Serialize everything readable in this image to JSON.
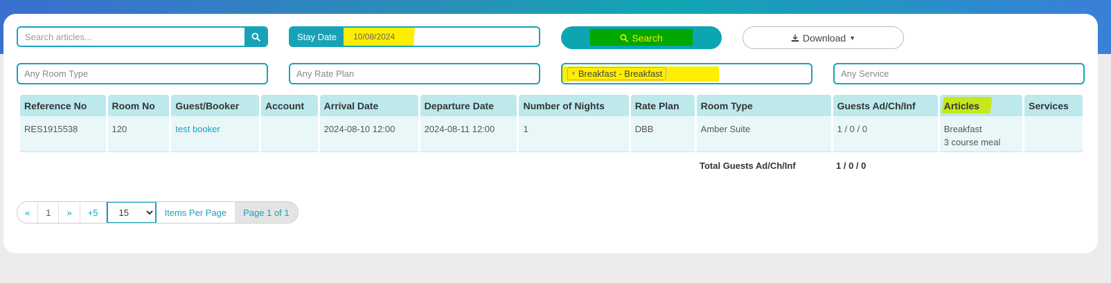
{
  "filters": {
    "search_placeholder": "Search articles...",
    "stay_date_label": "Stay Date",
    "stay_date_value": "10/08/2024",
    "search_button": "Search",
    "download_button": "Download",
    "room_type_placeholder": "Any Room Type",
    "rate_plan_placeholder": "Any Rate Plan",
    "article_tag": "Breakfast - Breakfast",
    "service_placeholder": "Any Service"
  },
  "table": {
    "headers": [
      "Reference No",
      "Room No",
      "Guest/Booker",
      "Account",
      "Arrival Date",
      "Departure Date",
      "Number of Nights",
      "Rate Plan",
      "Room Type",
      "Guests Ad/Ch/Inf",
      "Articles",
      "Services"
    ],
    "rows": [
      {
        "reference": "RES1915538",
        "room": "120",
        "guest": "test booker",
        "account": "",
        "arrival": "2024-08-10 12:00",
        "departure": "2024-08-11 12:00",
        "nights": "1",
        "rate_plan": "DBB",
        "room_type": "Amber Suite",
        "guests": "1 / 0 / 0",
        "articles_line1": "Breakfast",
        "articles_line2": "3 course meal",
        "services": ""
      }
    ],
    "totals_label": "Total Guests Ad/Ch/Inf",
    "totals_value": "1 / 0 / 0"
  },
  "pagination": {
    "first": "«",
    "page": "1",
    "next": "»",
    "plus": "+5",
    "per_page": "15",
    "items_per_page_label": "Items Per Page",
    "page_info": "Page 1 of 1"
  },
  "colors": {
    "accent": "#17a2b8",
    "highlight_yellow": "#ffee00",
    "highlight_green": "#00a800"
  }
}
